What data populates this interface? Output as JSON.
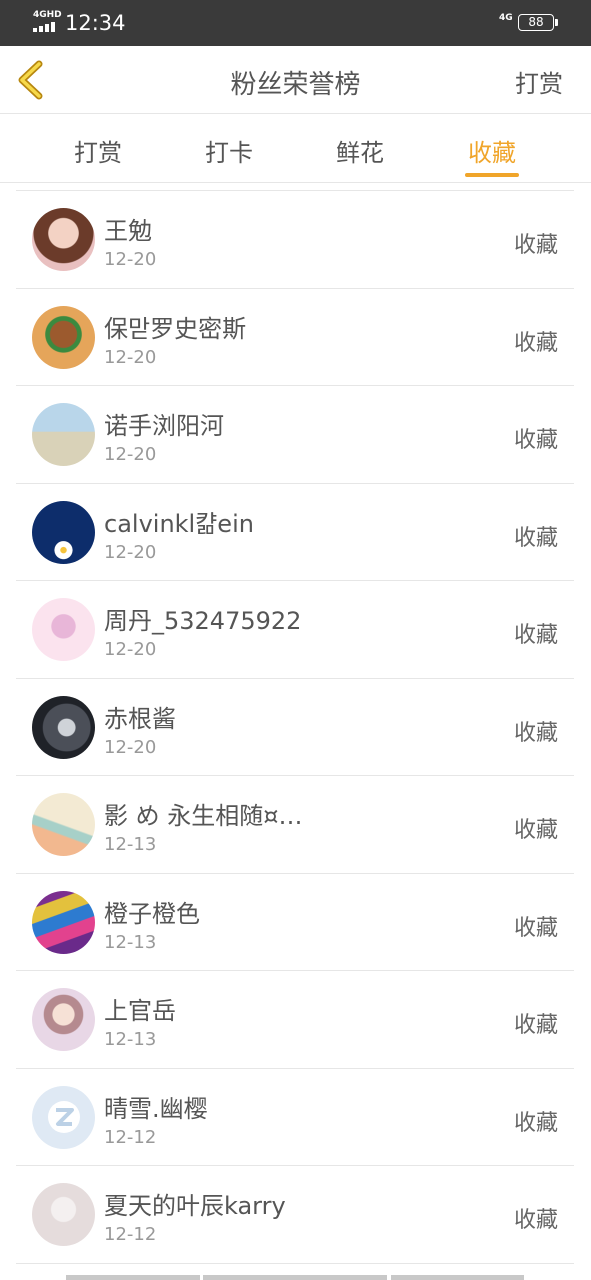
{
  "status_bar": {
    "network": "4GHD",
    "time": "12:34",
    "network_right": "4G",
    "battery": "88"
  },
  "nav": {
    "back_icon": "chevron-left-icon",
    "title": "粉丝荣誉榜",
    "action": "打赏"
  },
  "tabs": [
    {
      "label": "打赏",
      "active": false
    },
    {
      "label": "打卡",
      "active": false
    },
    {
      "label": "鲜花",
      "active": false
    },
    {
      "label": "收藏",
      "active": true
    }
  ],
  "colors": {
    "accent": "#f0a52a",
    "status_bar_bg": "#3a3a3a"
  },
  "fans": [
    {
      "name": "王勉",
      "date": "12-20",
      "action": "收藏"
    },
    {
      "name": "保맏罗史密斯",
      "date": "12-20",
      "action": "收藏"
    },
    {
      "name": "诺手浏阳河",
      "date": "12-20",
      "action": "收藏"
    },
    {
      "name": "calvinkl캶ein",
      "date": "12-20",
      "action": "收藏"
    },
    {
      "name": "周丹_532475922",
      "date": "12-20",
      "action": "收藏"
    },
    {
      "name": "赤根酱",
      "date": "12-20",
      "action": "收藏"
    },
    {
      "name": "影 め 永生相随¤…",
      "date": "12-13",
      "action": "收藏"
    },
    {
      "name": "橙子橙色",
      "date": "12-13",
      "action": "收藏"
    },
    {
      "name": "上官岳",
      "date": "12-13",
      "action": "收藏"
    },
    {
      "name": "晴雪.幽樱",
      "date": "12-12",
      "action": "收藏"
    },
    {
      "name": "夏天的叶辰karry",
      "date": "12-12",
      "action": "收藏"
    }
  ]
}
